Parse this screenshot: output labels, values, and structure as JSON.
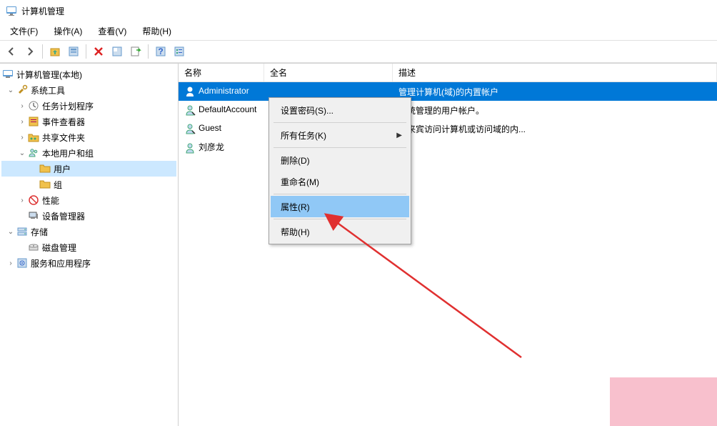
{
  "window": {
    "title": "计算机管理"
  },
  "menu": {
    "file": "文件(F)",
    "action": "操作(A)",
    "view": "查看(V)",
    "help": "帮助(H)"
  },
  "tree": {
    "root": "计算机管理(本地)",
    "system_tools": "系统工具",
    "task_scheduler": "任务计划程序",
    "event_viewer": "事件查看器",
    "shared_folders": "共享文件夹",
    "local_users_groups": "本地用户和组",
    "users": "用户",
    "groups": "组",
    "performance": "性能",
    "device_manager": "设备管理器",
    "storage": "存储",
    "disk_management": "磁盘管理",
    "services_apps": "服务和应用程序"
  },
  "columns": {
    "name": "名称",
    "full_name": "全名",
    "description": "描述"
  },
  "users_list": [
    {
      "name": "Administrator",
      "full_name": "",
      "description": "管理计算机(域)的内置帐户",
      "selected": true
    },
    {
      "name": "DefaultAccount",
      "full_name": "",
      "description": "系统管理的用户帐户。",
      "selected": false
    },
    {
      "name": "Guest",
      "full_name": "",
      "description": "供来宾访问计算机或访问域的内...",
      "selected": false
    },
    {
      "name": "刘彦龙",
      "full_name": "",
      "description": "",
      "selected": false
    }
  ],
  "context_menu": {
    "set_password": "设置密码(S)...",
    "all_tasks": "所有任务(K)",
    "delete": "删除(D)",
    "rename": "重命名(M)",
    "properties": "属性(R)",
    "help": "帮助(H)"
  }
}
